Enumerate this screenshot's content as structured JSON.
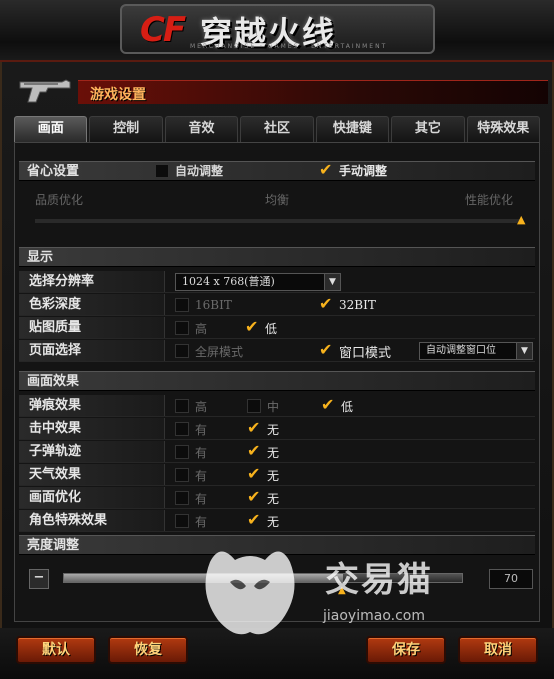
{
  "header": {
    "logo_mark": "CF",
    "logo_text": "穿越火线",
    "logo_sub": "MERCHANDISE · GAMES · ENTERTAINMENT"
  },
  "dialog": {
    "title": "游戏设置"
  },
  "tabs": [
    {
      "label": "画面",
      "active": true
    },
    {
      "label": "控制",
      "active": false
    },
    {
      "label": "音效",
      "active": false
    },
    {
      "label": "社区",
      "active": false
    },
    {
      "label": "快捷键",
      "active": false
    },
    {
      "label": "其它",
      "active": false
    },
    {
      "label": "特殊效果",
      "active": false
    }
  ],
  "quality": {
    "header": "省心设置",
    "auto_label": "自动调整",
    "manual_label": "手动调整",
    "selected": "manual",
    "left_label": "品质优化",
    "mid_label": "均衡",
    "right_label": "性能优化",
    "slider_level": 1.0
  },
  "display": {
    "header": "显示",
    "resolution_label": "选择分辨率",
    "resolution_value": "1024 x 768(普通)",
    "color_label": "色彩深度",
    "color_opt1": "16BIT",
    "color_opt2": "32BIT",
    "texture_label": "贴图质量",
    "texture_opt1": "高",
    "texture_opt2": "低",
    "page_label": "页面选择",
    "page_opt1": "全屏模式",
    "page_opt2": "窗口模式",
    "window_select": "自动调整窗口位"
  },
  "effects": {
    "header": "画面效果",
    "rows": [
      {
        "label": "弹痕效果",
        "options": [
          "高",
          "中",
          "低"
        ],
        "checked": 2
      },
      {
        "label": "击中效果",
        "options": [
          "有",
          "无"
        ],
        "checked": 1
      },
      {
        "label": "子弹轨迹",
        "options": [
          "有",
          "无"
        ],
        "checked": 1
      },
      {
        "label": "天气效果",
        "options": [
          "有",
          "无"
        ],
        "checked": 1
      },
      {
        "label": "画面优化",
        "options": [
          "有",
          "无"
        ],
        "checked": 1
      },
      {
        "label": "角色特殊效果",
        "options": [
          "有",
          "无"
        ],
        "checked": 1
      }
    ]
  },
  "brightness": {
    "header": "亮度调整",
    "value": "70",
    "minus": "−",
    "level": 0.7
  },
  "buttons": {
    "default": "默认",
    "restore": "恢复",
    "save": "保存",
    "cancel": "取消"
  },
  "watermark": {
    "text": "交易猫",
    "url": "jiaoyimao.com"
  },
  "colors": {
    "accent": "#f7b21d",
    "title_red": "#6a0f08",
    "button": "#b13a10"
  }
}
